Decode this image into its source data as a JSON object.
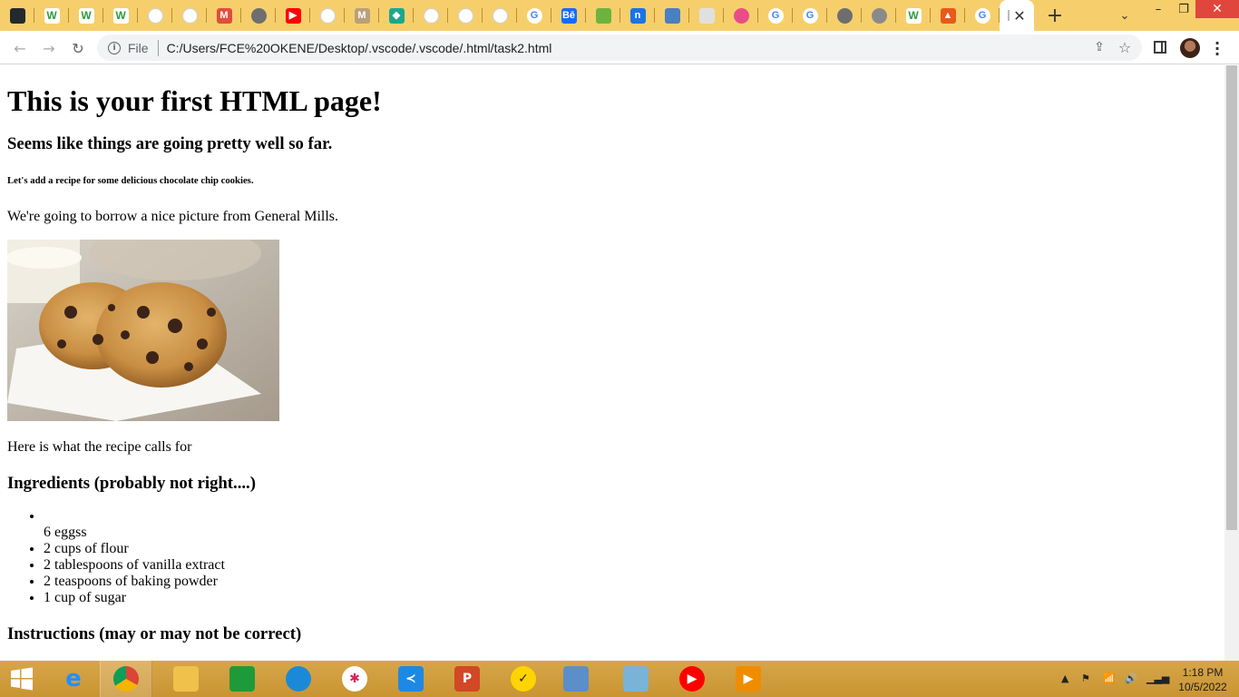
{
  "browser": {
    "tabs": [
      {
        "icon": "github-icon",
        "glyph": "",
        "color": "#24292e"
      },
      {
        "icon": "w-icon",
        "glyph": "W",
        "color": "#2e9b3b"
      },
      {
        "icon": "w-icon",
        "glyph": "W",
        "color": "#2e9b3b"
      },
      {
        "icon": "w-icon",
        "glyph": "W",
        "color": "#2e9b3b"
      },
      {
        "icon": "page-icon",
        "glyph": "",
        "color": "#ffffff"
      },
      {
        "icon": "page-icon",
        "glyph": "",
        "color": "#ffffff"
      },
      {
        "icon": "gmail-icon",
        "glyph": "M",
        "color": "#e14d3c"
      },
      {
        "icon": "globe-icon",
        "glyph": "",
        "color": "#6e6e6e"
      },
      {
        "icon": "youtube-icon",
        "glyph": "▶",
        "color": "#ff0000"
      },
      {
        "icon": "page-icon",
        "glyph": "",
        "color": "#ffffff"
      },
      {
        "icon": "gmail-icon",
        "glyph": "M",
        "color": "#b9a07a"
      },
      {
        "icon": "diamond-icon",
        "glyph": "◆",
        "color": "#19a88e"
      },
      {
        "icon": "page-icon",
        "glyph": "",
        "color": "#ffffff"
      },
      {
        "icon": "page-icon",
        "glyph": "",
        "color": "#ffffff"
      },
      {
        "icon": "page-icon",
        "glyph": "",
        "color": "#ffffff"
      },
      {
        "icon": "google-icon",
        "glyph": "G",
        "color": "#4285f4"
      },
      {
        "icon": "behance-icon",
        "glyph": "Bē",
        "color": "#1769ff"
      },
      {
        "icon": "leaf-icon",
        "glyph": "",
        "color": "#6db33f"
      },
      {
        "icon": "n-icon",
        "glyph": "n",
        "color": "#1a73e8"
      },
      {
        "icon": "bird-icon",
        "glyph": "",
        "color": "#4a7fc1"
      },
      {
        "icon": "doc-icon",
        "glyph": "",
        "color": "#e0e0e0"
      },
      {
        "icon": "dribbble-icon",
        "glyph": "",
        "color": "#ea4c89"
      },
      {
        "icon": "google-icon",
        "glyph": "G",
        "color": "#4285f4"
      },
      {
        "icon": "google-icon",
        "glyph": "G",
        "color": "#4285f4"
      },
      {
        "icon": "globe-icon",
        "glyph": "",
        "color": "#6e6e6e"
      },
      {
        "icon": "globe-icon",
        "glyph": "",
        "color": "#8a8a8a"
      },
      {
        "icon": "w-icon",
        "glyph": "W",
        "color": "#2e9b3b"
      },
      {
        "icon": "mountain-icon",
        "glyph": "▲",
        "color": "#e8591a"
      },
      {
        "icon": "google-icon",
        "glyph": "G",
        "color": "#4285f4"
      }
    ],
    "active_tab_close": "✕",
    "new_tab": "+",
    "tab_search": "⌄",
    "window_controls": {
      "minimize": "–",
      "restore": "❐",
      "close": "✕"
    },
    "nav": {
      "back": "←",
      "forward": "→",
      "reload": "↻"
    },
    "address": {
      "scheme_label": "File",
      "url": "C:/Users/FCE%20OKENE/Desktop/.vscode/.vscode/.html/task2.html"
    }
  },
  "page": {
    "h1": "This is your first HTML page!",
    "h3": "Seems like things are going pretty well so far.",
    "h6": "Let's add a recipe for some delicious chocolate chip cookies.",
    "intro": "We're going to borrow a nice picture from General Mills.",
    "recipe_intro": "Here is what the recipe calls for",
    "ingredients_heading": "Ingredients (probably not right....)",
    "ingredients_first_bullet": "",
    "ingredients_first_text": "6 eggss",
    "ingredients": [
      "2 cups of flour",
      "2 tablespoons of vanilla extract",
      "2 teaspoons of baking powder",
      "1 cup of sugar"
    ],
    "instructions_heading": "Instructions (may or may not be correct)"
  },
  "taskbar": {
    "apps": [
      {
        "name": "ie",
        "glyph": "e",
        "color": "#1e90ff"
      },
      {
        "name": "chrome",
        "glyph": "",
        "color": "#db4437"
      },
      {
        "name": "file-explorer",
        "glyph": "",
        "color": "#f0c14b"
      },
      {
        "name": "store",
        "glyph": "",
        "color": "#1f9a3a"
      },
      {
        "name": "edge",
        "glyph": "",
        "color": "#1b8ad6"
      },
      {
        "name": "slack",
        "glyph": "✱",
        "color": "#ffffff"
      },
      {
        "name": "vscode",
        "glyph": "≺",
        "color": "#1e88e5"
      },
      {
        "name": "powerpoint",
        "glyph": "P",
        "color": "#d24726"
      },
      {
        "name": "norton",
        "glyph": "✓",
        "color": "#ffd400"
      },
      {
        "name": "photos",
        "glyph": "",
        "color": "#5a8fc9"
      },
      {
        "name": "notepad",
        "glyph": "",
        "color": "#7ab3d8"
      },
      {
        "name": "youtube-music",
        "glyph": "▶",
        "color": "#ff0000"
      },
      {
        "name": "media-player",
        "glyph": "▶",
        "color": "#f08c00"
      }
    ],
    "tray": {
      "flag": "⚑",
      "network": "📶",
      "volume": "🔊"
    },
    "clock": {
      "time": "1:18 PM",
      "date": "10/5/2022"
    }
  }
}
